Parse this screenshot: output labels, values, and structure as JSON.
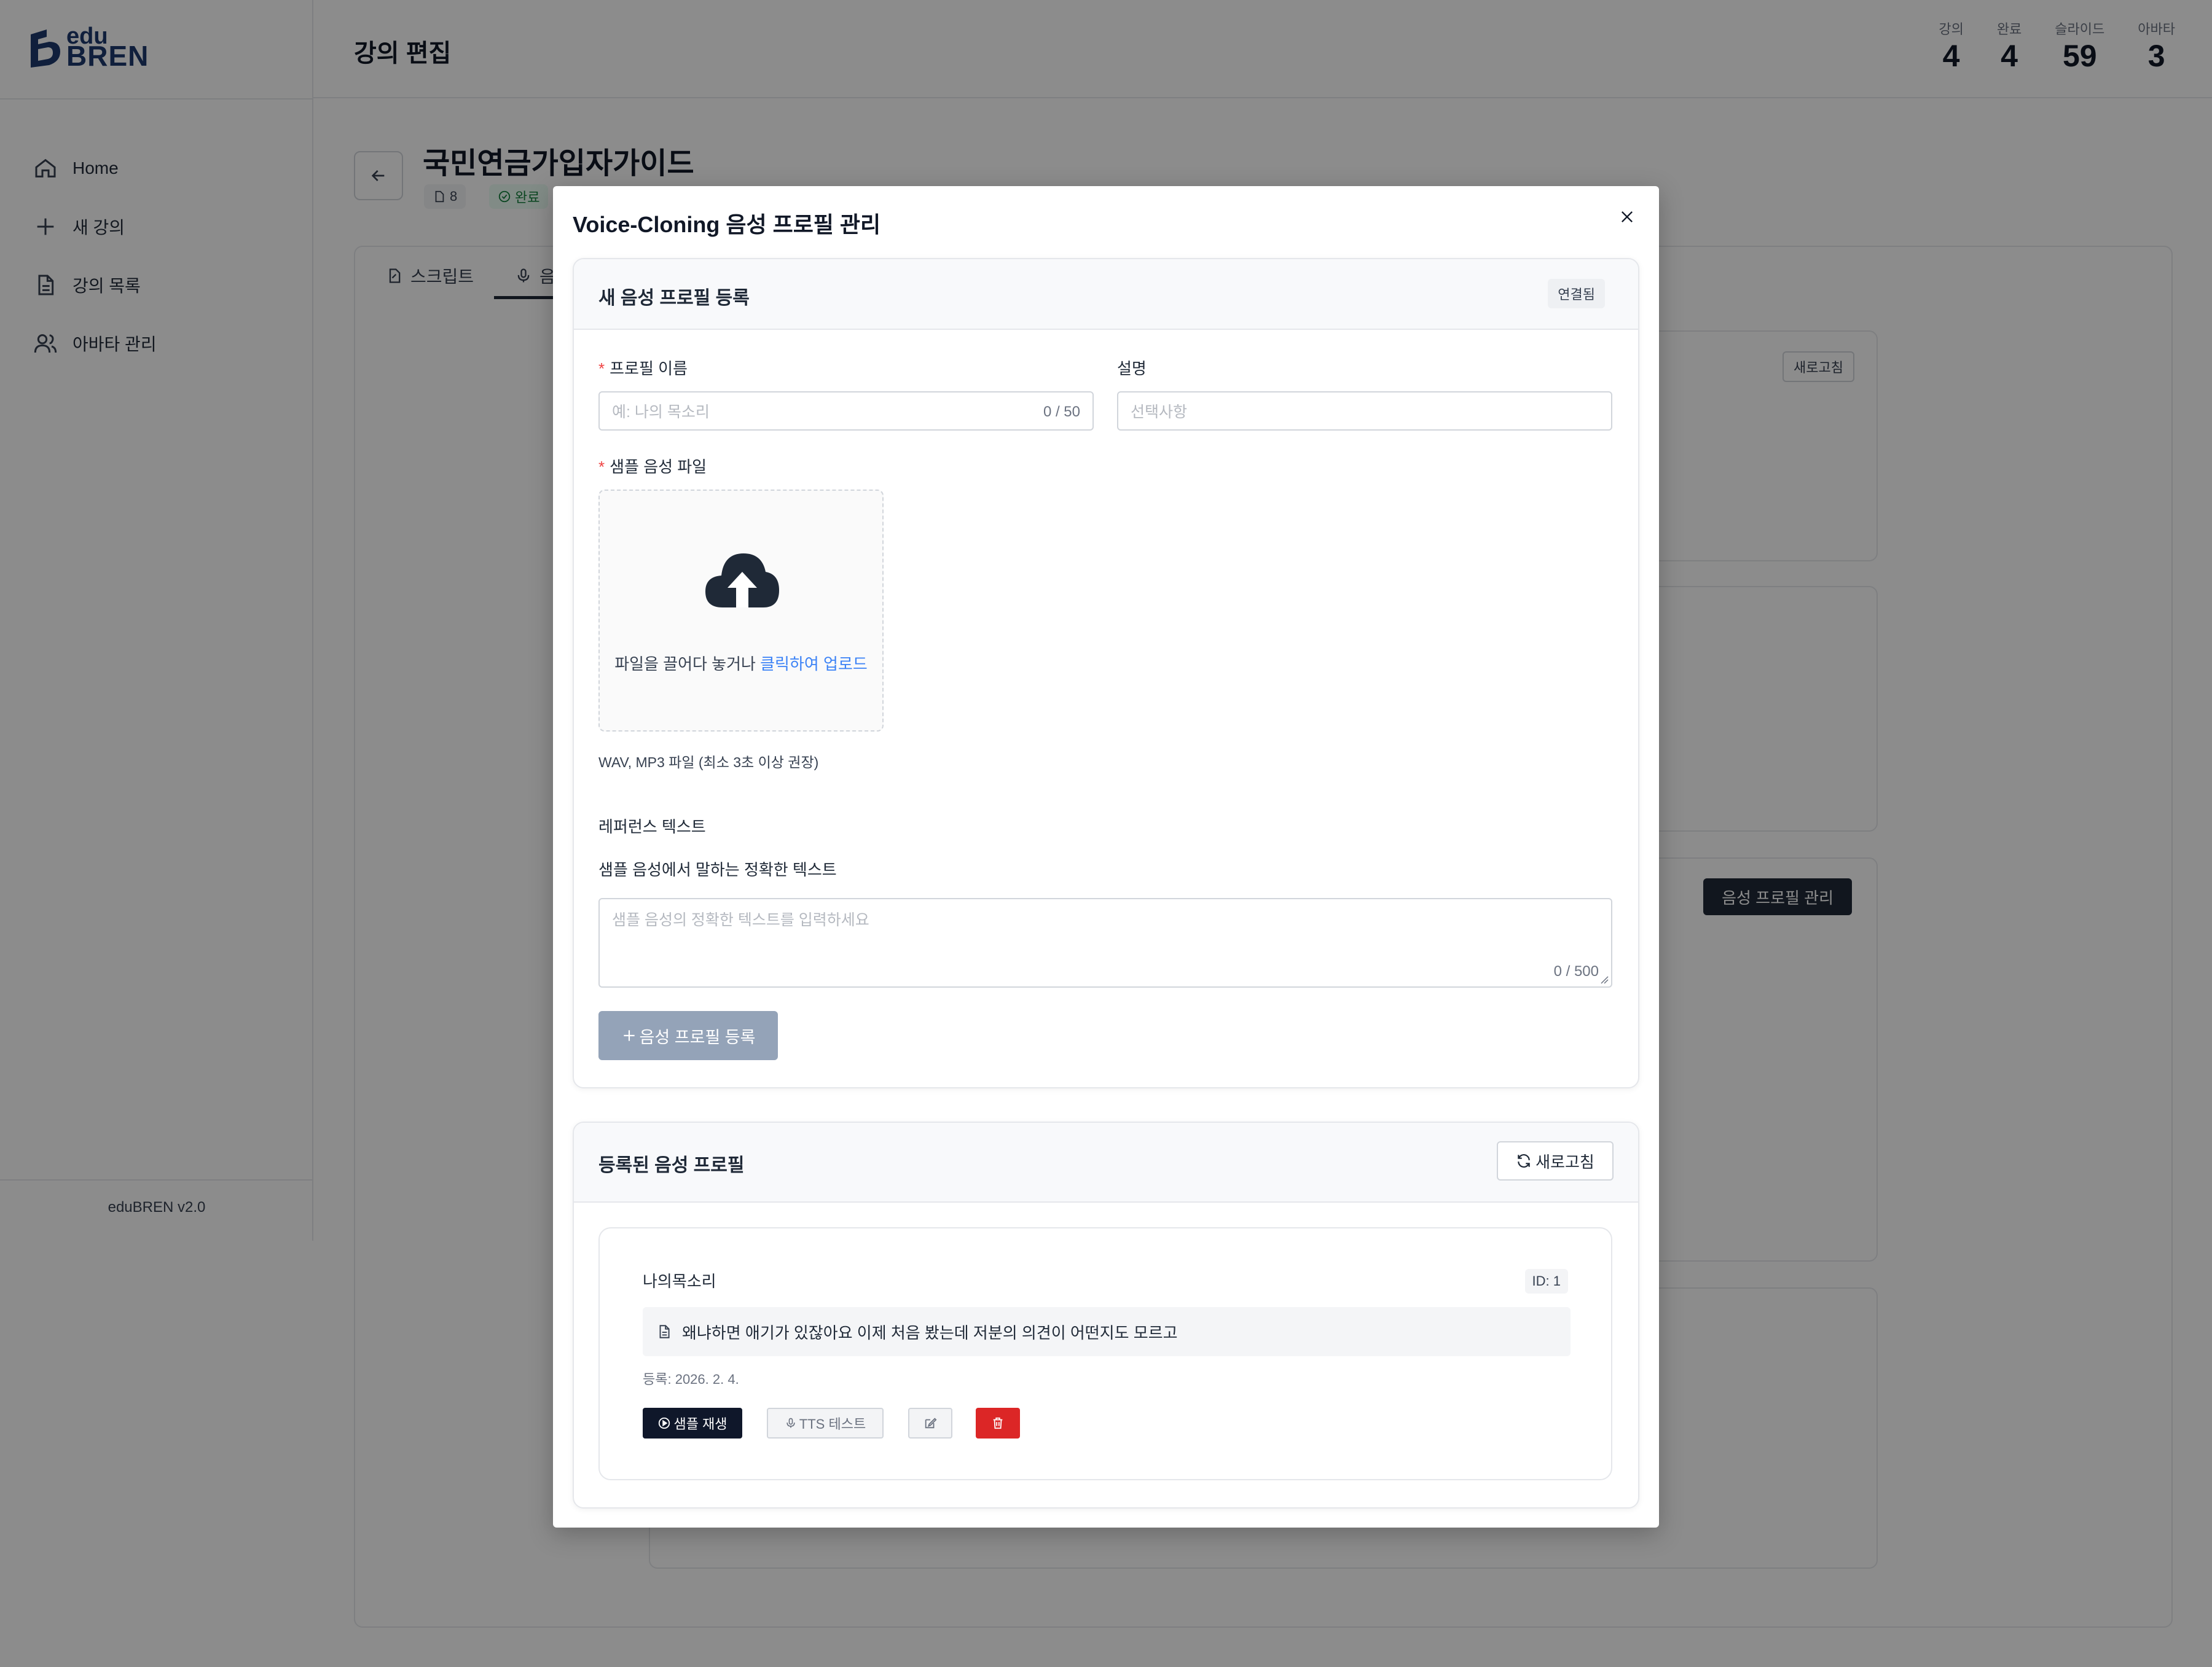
{
  "app": {
    "logo_edu": "edu",
    "logo_bren": "BREN",
    "version": "eduBREN v2.0",
    "nav": [
      {
        "label": "Home",
        "icon": "home-icon"
      },
      {
        "label": "새 강의",
        "icon": "plus-icon"
      },
      {
        "label": "강의 목록",
        "icon": "document-icon"
      },
      {
        "label": "아바타 관리",
        "icon": "users-icon"
      }
    ]
  },
  "header": {
    "title": "강의 편집",
    "stats": [
      {
        "label": "강의",
        "value": "4"
      },
      {
        "label": "완료",
        "value": "4"
      },
      {
        "label": "슬라이드",
        "value": "59"
      },
      {
        "label": "아바타",
        "value": "3"
      }
    ]
  },
  "course": {
    "title": "국민연금가입자가이드",
    "doc_count": "8",
    "status": "완료",
    "tabs": [
      "스크립트",
      "음"
    ],
    "bg_refresh_label": "새로고침",
    "bg_manage_label": "음성 프로필 관리"
  },
  "modal": {
    "title": "Voice-Cloning 음성 프로필 관리",
    "register": {
      "title": "새 음성 프로필 등록",
      "status_badge": "연결됨",
      "name_label": "프로필 이름",
      "name_placeholder": "예: 나의 목소리",
      "name_counter": "0 / 50",
      "desc_label": "설명",
      "desc_placeholder": "선택사항",
      "file_label": "샘플 음성 파일",
      "drop_text": "파일을 끌어다 놓거나 ",
      "drop_link": "클릭하여 업로드",
      "file_hint": "WAV, MP3 파일 (최소 3초 이상 권장)",
      "ref_label": "레퍼런스 텍스트",
      "ref_desc": "샘플 음성에서 말하는 정확한 텍스트",
      "ref_placeholder": "샘플 음성의 정확한 텍스트를 입력하세요",
      "ref_counter": "0 / 500",
      "submit_label": "음성 프로필 등록"
    },
    "registered": {
      "title": "등록된 음성 프로필",
      "refresh_label": "새로고침",
      "profiles": [
        {
          "name": "나의목소리",
          "id": "ID: 1",
          "reference_text": "왜냐하면 애기가 있잖아요 이제 처음 봤는데 저분의 의견이 어떤지도 모르고",
          "registered": "등록: 2026. 2. 4.",
          "play_label": "샘플 재생",
          "tts_label": "TTS 테스트"
        }
      ]
    }
  },
  "colors": {
    "accent_link": "#3b82f6",
    "primary_dark": "#0f172a",
    "danger": "#dc2626",
    "disabled_button": "#94a3b8",
    "required": "#ef4444"
  }
}
